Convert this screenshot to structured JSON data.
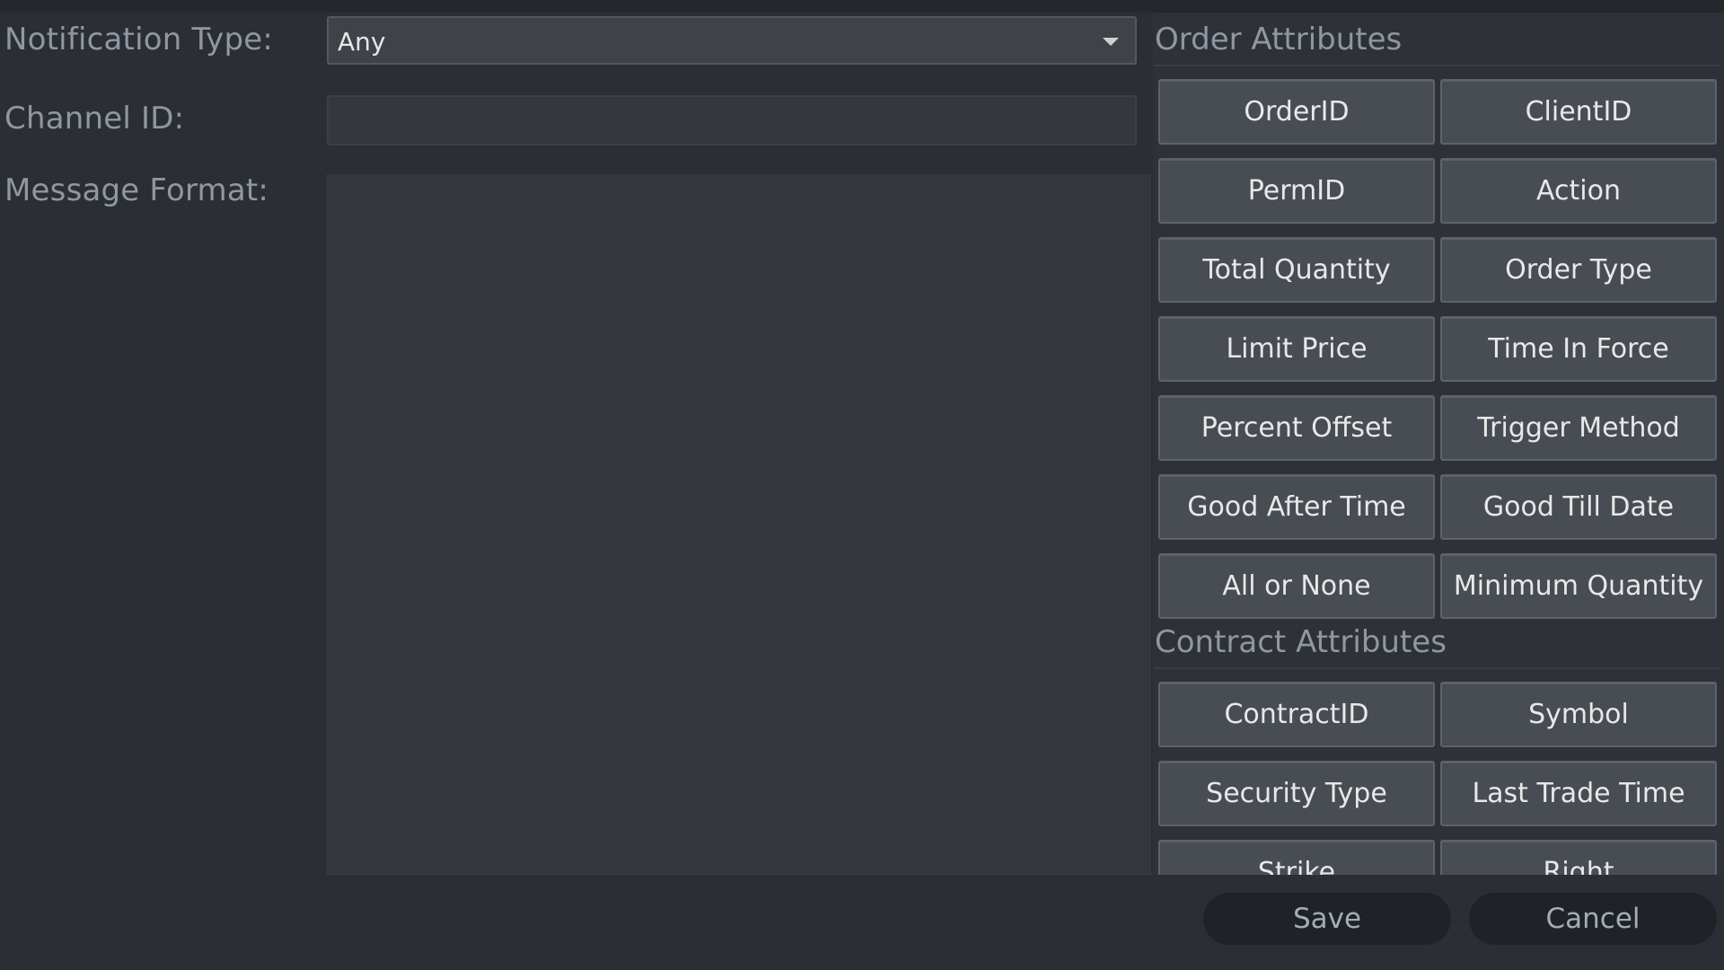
{
  "form": {
    "notification_type_label": "Notification Type:",
    "notification_type_value": "Any",
    "channel_id_label": "Channel ID:",
    "channel_id_value": "",
    "message_format_label": "Message Format:",
    "message_format_value": ""
  },
  "order_attributes": {
    "title": "Order Attributes",
    "buttons": [
      "OrderID",
      "ClientID",
      "PermID",
      "Action",
      "Total Quantity",
      "Order Type",
      "Limit Price",
      "Time In Force",
      "Percent Offset",
      "Trigger Method",
      "Good After Time",
      "Good Till Date",
      "All or None",
      "Minimum Quantity"
    ]
  },
  "contract_attributes": {
    "title": "Contract Attributes",
    "buttons": [
      "ContractID",
      "Symbol",
      "Security Type",
      "Last Trade Time",
      "Strike",
      "Right"
    ]
  },
  "actions": {
    "save": "Save",
    "cancel": "Cancel"
  }
}
